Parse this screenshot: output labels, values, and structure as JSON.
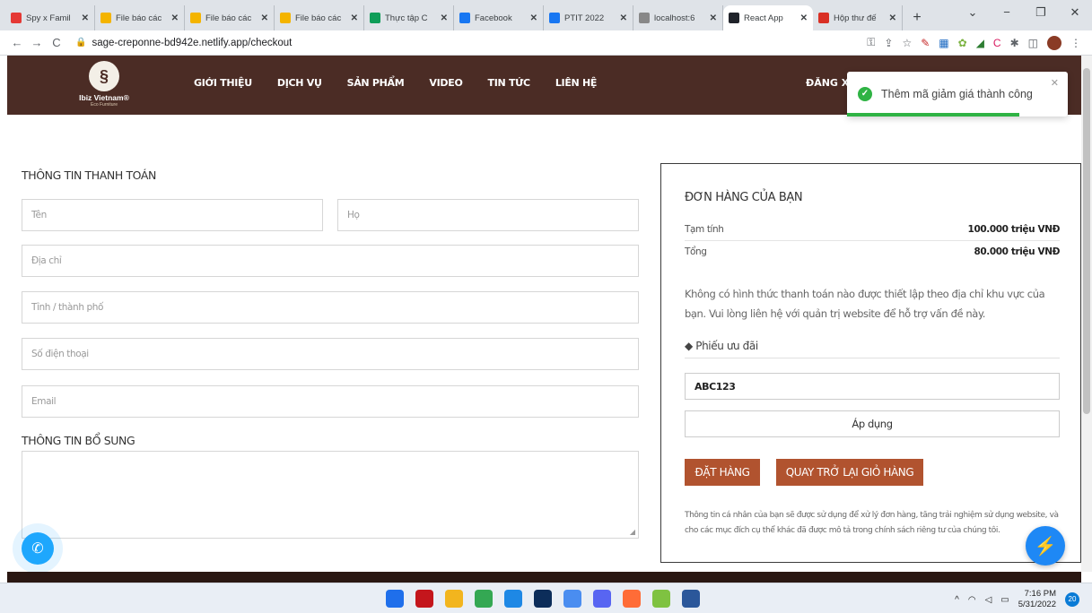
{
  "browser": {
    "tabs": [
      {
        "title": "Spy x Famil",
        "color": "#e53935"
      },
      {
        "title": "File báo các",
        "color": "#f4b400"
      },
      {
        "title": "File báo các",
        "color": "#f4b400"
      },
      {
        "title": "File báo các",
        "color": "#f4b400"
      },
      {
        "title": "Thực tập C",
        "color": "#0f9d58"
      },
      {
        "title": "Facebook",
        "color": "#1877f2"
      },
      {
        "title": "PTIT 2022",
        "color": "#1877f2"
      },
      {
        "title": "localhost:6",
        "color": "#888888"
      },
      {
        "title": "React App",
        "color": "#20232a",
        "active": true
      },
      {
        "title": "Hộp thư đế",
        "color": "#d93025"
      }
    ],
    "url": "sage-creponne-bd942e.netlify.app/checkout",
    "new_tab": "+"
  },
  "site": {
    "logo_name": "Ibiz Vietnam®",
    "logo_sub": "Eco Furniture",
    "menu": [
      "GIỚI THIỆU",
      "DỊCH VỤ",
      "SẢN PHẨM",
      "VIDEO",
      "TIN TỨC",
      "LIÊN HỆ"
    ],
    "logout": "ĐĂNG XUẤ"
  },
  "toast": {
    "message": "Thêm mã giảm giá thành công",
    "progress": 0.78,
    "color": "#2fb344"
  },
  "billing": {
    "title": "THÔNG TIN THANH TOÁN",
    "first_name_placeholder": "Tên",
    "last_name_placeholder": "Họ",
    "address_placeholder": "Địa chỉ",
    "city_placeholder": "Tỉnh / thành phố",
    "phone_placeholder": "Số điện thoại",
    "email_placeholder": "Email"
  },
  "additional": {
    "title": "THÔNG TIN BỔ SUNG"
  },
  "order": {
    "title": "ĐƠN HÀNG CỦA BẠN",
    "subtotal_label": "Tạm tính",
    "subtotal_value": "100.000 triệu VNĐ",
    "total_label": "Tổng",
    "total_value": "80.000 triệu VNĐ",
    "note": "Không có hình thức thanh toán nào được thiết lập theo địa chỉ khu vực của bạn. Vui lòng liên hệ với quản trị website để hỗ trợ vấn đề này.",
    "coupon_label": "Phiếu ưu đãi",
    "coupon_value": "ABC123",
    "apply_label": "Áp dụng",
    "place_order": "ĐẶT HÀNG",
    "back_to_cart": "QUAY TRỞ LẠI GIỎ HÀNG",
    "privacy": "Thông tin cá nhân của bạn sẽ được sử dụng để xử lý đơn hàng, tăng trải nghiệm sử dụng website, và cho các mục đích cụ thể khác đã được mô tả trong chính sách riêng tư của chúng tôi.",
    "accent": "#b1532f"
  },
  "taskbar": {
    "time": "7:16 PM",
    "date": "5/31/2022",
    "notifications": "20",
    "apps": [
      {
        "name": "windows-start",
        "color": "#1f6feb"
      },
      {
        "name": "netflix",
        "color": "#c4161c"
      },
      {
        "name": "file-explorer",
        "color": "#f2b51e"
      },
      {
        "name": "chrome",
        "color": "#34a853"
      },
      {
        "name": "vscode",
        "color": "#1e88e5"
      },
      {
        "name": "photoshop",
        "color": "#0c2d5a"
      },
      {
        "name": "app-hex",
        "color": "#4a8df0"
      },
      {
        "name": "discord",
        "color": "#5865f2"
      },
      {
        "name": "postman",
        "color": "#ff6c37"
      },
      {
        "name": "app-green",
        "color": "#7fc241"
      },
      {
        "name": "word",
        "color": "#2b579a"
      }
    ]
  }
}
